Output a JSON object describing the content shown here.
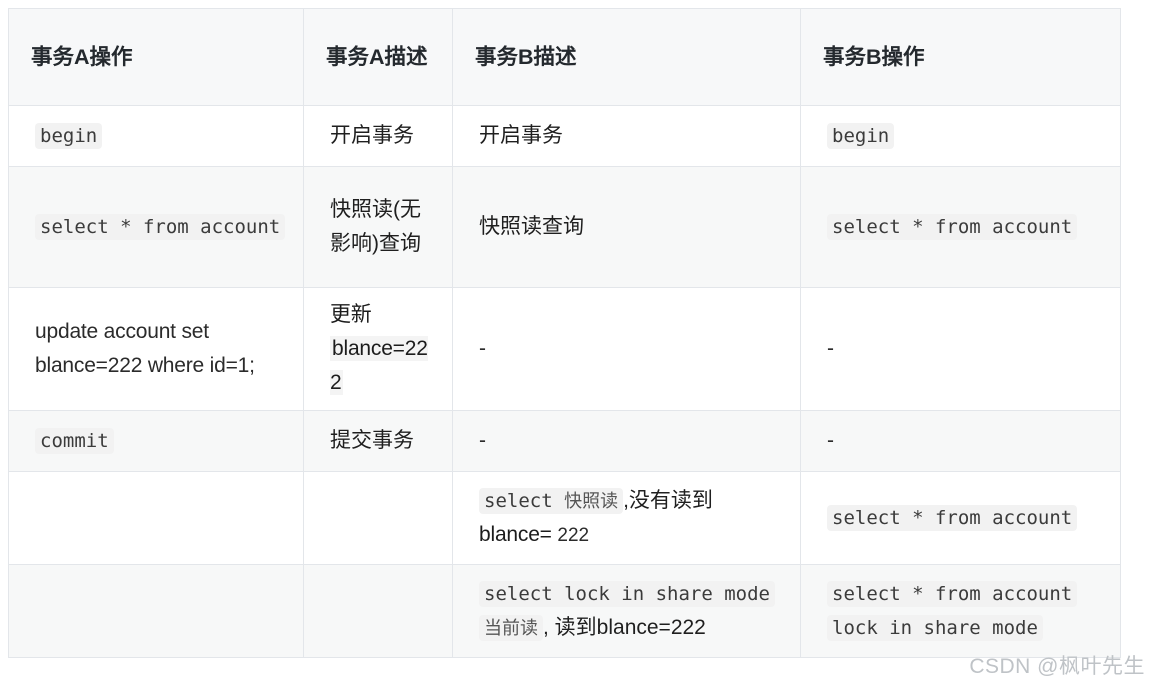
{
  "table": {
    "headers": [
      "事务A操作",
      "事务A描述",
      "事务B描述",
      "事务B操作"
    ],
    "rows": [
      {
        "a_op": "begin",
        "a_desc": "开启事务",
        "b_desc": "开启事务",
        "b_op": "begin"
      },
      {
        "a_op": "select * from account",
        "a_desc": "快照读(无影响)查询",
        "b_desc": "快照读查询",
        "b_op": "select * from account"
      },
      {
        "a_op": "update account set blance=222 where id=1;",
        "a_desc_line1": "更新",
        "a_desc_line2": "blance=222",
        "b_desc": "-",
        "b_op": "-"
      },
      {
        "a_op": "commit",
        "a_desc": "提交事务",
        "b_desc": "-",
        "b_op": "-"
      },
      {
        "a_op": "",
        "a_desc": "",
        "b_desc_code_en": "select ",
        "b_desc_code_cn": "快照读",
        "b_desc_tail": ",没有读到",
        "b_desc_line2_label": "blance= ",
        "b_desc_line2_value": "222",
        "b_op": "select * from account"
      },
      {
        "a_op": "",
        "a_desc": "",
        "b_desc_code_en": "select lock in share mode",
        "b_desc_code_cn": "当前读",
        "b_desc_tail": ", 读到blance=222",
        "b_op_line1": "select * from account",
        "b_op_line2": "lock in share mode"
      }
    ]
  },
  "watermark": "CSDN @枫叶先生",
  "colors": {
    "header_bg": "#f7f8f9",
    "stripe_bg": "#f7f8f8",
    "border": "#e3e6ea",
    "code_bg": "#f2f2f2",
    "text": "#2b2b2b",
    "watermark": "#bfc3c7"
  }
}
